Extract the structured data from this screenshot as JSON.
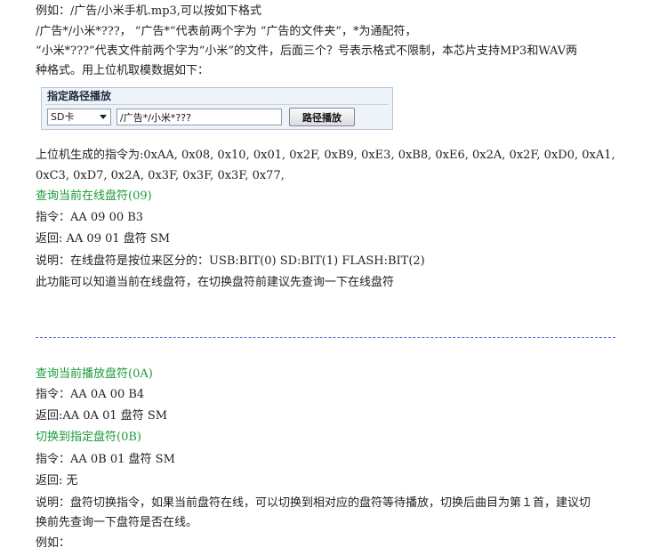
{
  "intro": {
    "line1": "例如：/广告/小米手机.mp3,可以按如下格式",
    "line2": "/广告*/小米*???，    “广告*”代表前两个字为 “广告的文件夹”，*为通配符，",
    "line3": "“小米*???”代表文件前两个字为“小米”的文件，后面三个？号表示格式不限制，本芯片支持MP3和WAV两",
    "line4": "种格式。用上位机取模数据如下："
  },
  "dialog": {
    "title": "指定路径播放",
    "drive_value": "SD卡",
    "path_value": "/广告*/小米*???",
    "button_label": "路径播放"
  },
  "generated": {
    "line1": "上位机生成的指令为:0xAA, 0x08, 0x10, 0x01, 0x2F, 0xB9, 0xE3, 0xB8, 0xE6, 0x2A, 0x2F, 0xD0, 0xA1,",
    "line2": "0xC3, 0xD7, 0x2A, 0x3F, 0x3F, 0x3F, 0x77,"
  },
  "section_09": {
    "heading": "查询当前在线盘符(09)",
    "command": "指令：AA 09 00 B3",
    "response": "返回:  AA 09 01 盘符 SM",
    "description": "说明：在线盘符是按位来区分的：USB:BIT(0)   SD:BIT(1)  FLASH:BIT(2)",
    "note": "此功能可以知道当前在线盘符，在切换盘符前建议先查询一下在线盘符"
  },
  "section_0a": {
    "heading": "查询当前播放盘符(0A)",
    "command": "指令：AA 0A 00 B4",
    "response": "返回:AA 0A 01 盘符 SM"
  },
  "section_0b": {
    "heading": "切换到指定盘符(0B)",
    "command": "指令：AA 0B 01 盘符 SM",
    "response": "返回:  无",
    "description1": "说明：盘符切换指令，如果当前盘符在线，可以切换到相对应的盘符等待播放，切换后曲目为第１首，建议切",
    "description2": "换前先查询一下盘符是否在线。",
    "example": "例如："
  },
  "colors": {
    "heading_green": "#1a9a3a",
    "divider_blue": "#3f5fd8",
    "text": "#222222"
  }
}
